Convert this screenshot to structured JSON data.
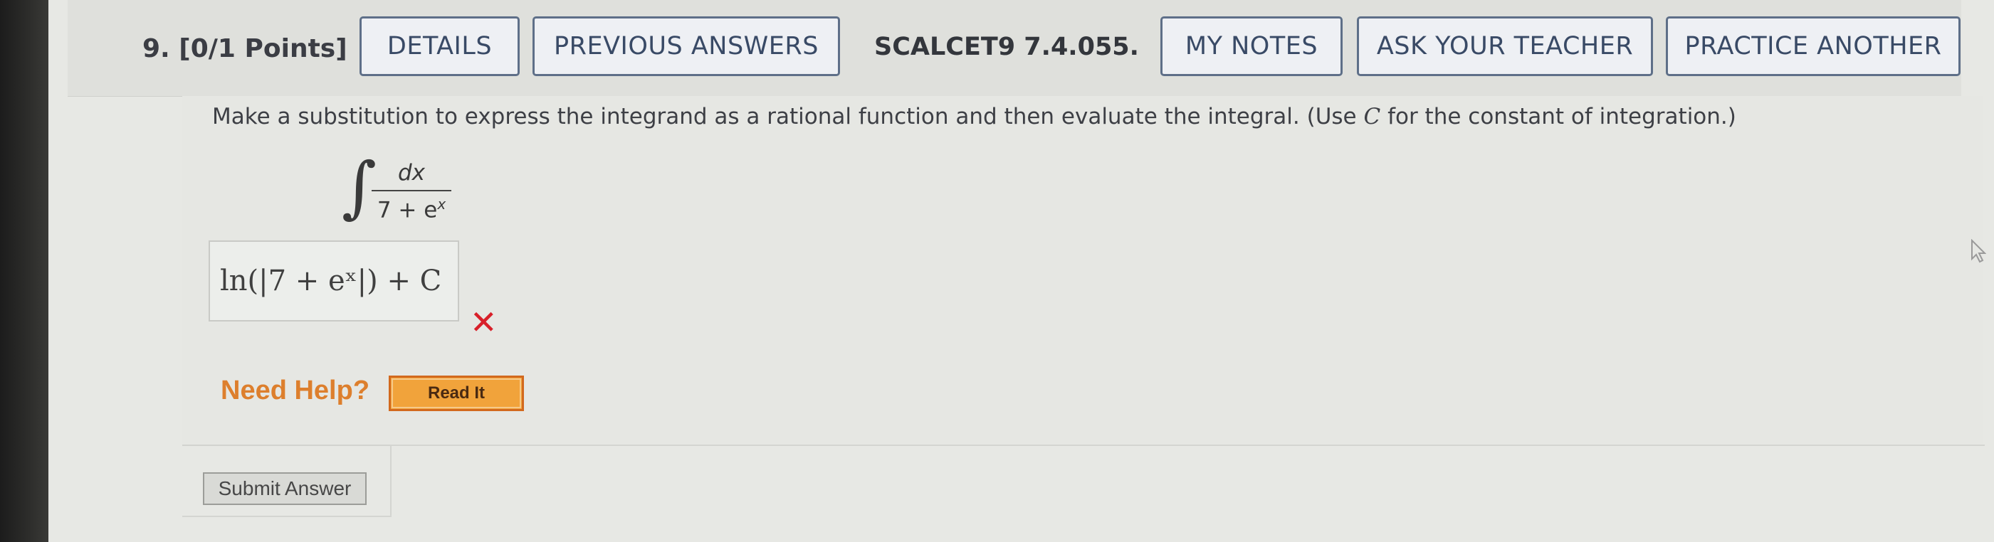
{
  "question": {
    "number": "9.",
    "points": "[0/1 Points]",
    "reference": "SCALCET9 7.4.055."
  },
  "header_buttons": {
    "details": "DETAILS",
    "previous_answers": "PREVIOUS ANSWERS",
    "my_notes": "MY NOTES",
    "ask_teacher": "ASK YOUR TEACHER",
    "practice_another": "PRACTICE ANOTHER"
  },
  "problem": {
    "instruction_before": "Make a substitution to express the integrand as a rational function and then evaluate the integral. (Use ",
    "instruction_var": "C",
    "instruction_after": " for the constant of integration.)",
    "integrand_numerator": "dx",
    "integrand_denominator_base": "7 + e",
    "integrand_denominator_exp": "x"
  },
  "answer": {
    "value": "ln(|7 + eˣ|) + C",
    "status": "incorrect"
  },
  "help": {
    "label": "Need Help?",
    "read_it": "Read It"
  },
  "submit": {
    "label": "Submit Answer"
  },
  "colors": {
    "button_border": "#5e6f88",
    "wrong_mark": "#d8202a",
    "help_text": "#dd7f2d",
    "read_it_bg": "#f1a33b"
  }
}
